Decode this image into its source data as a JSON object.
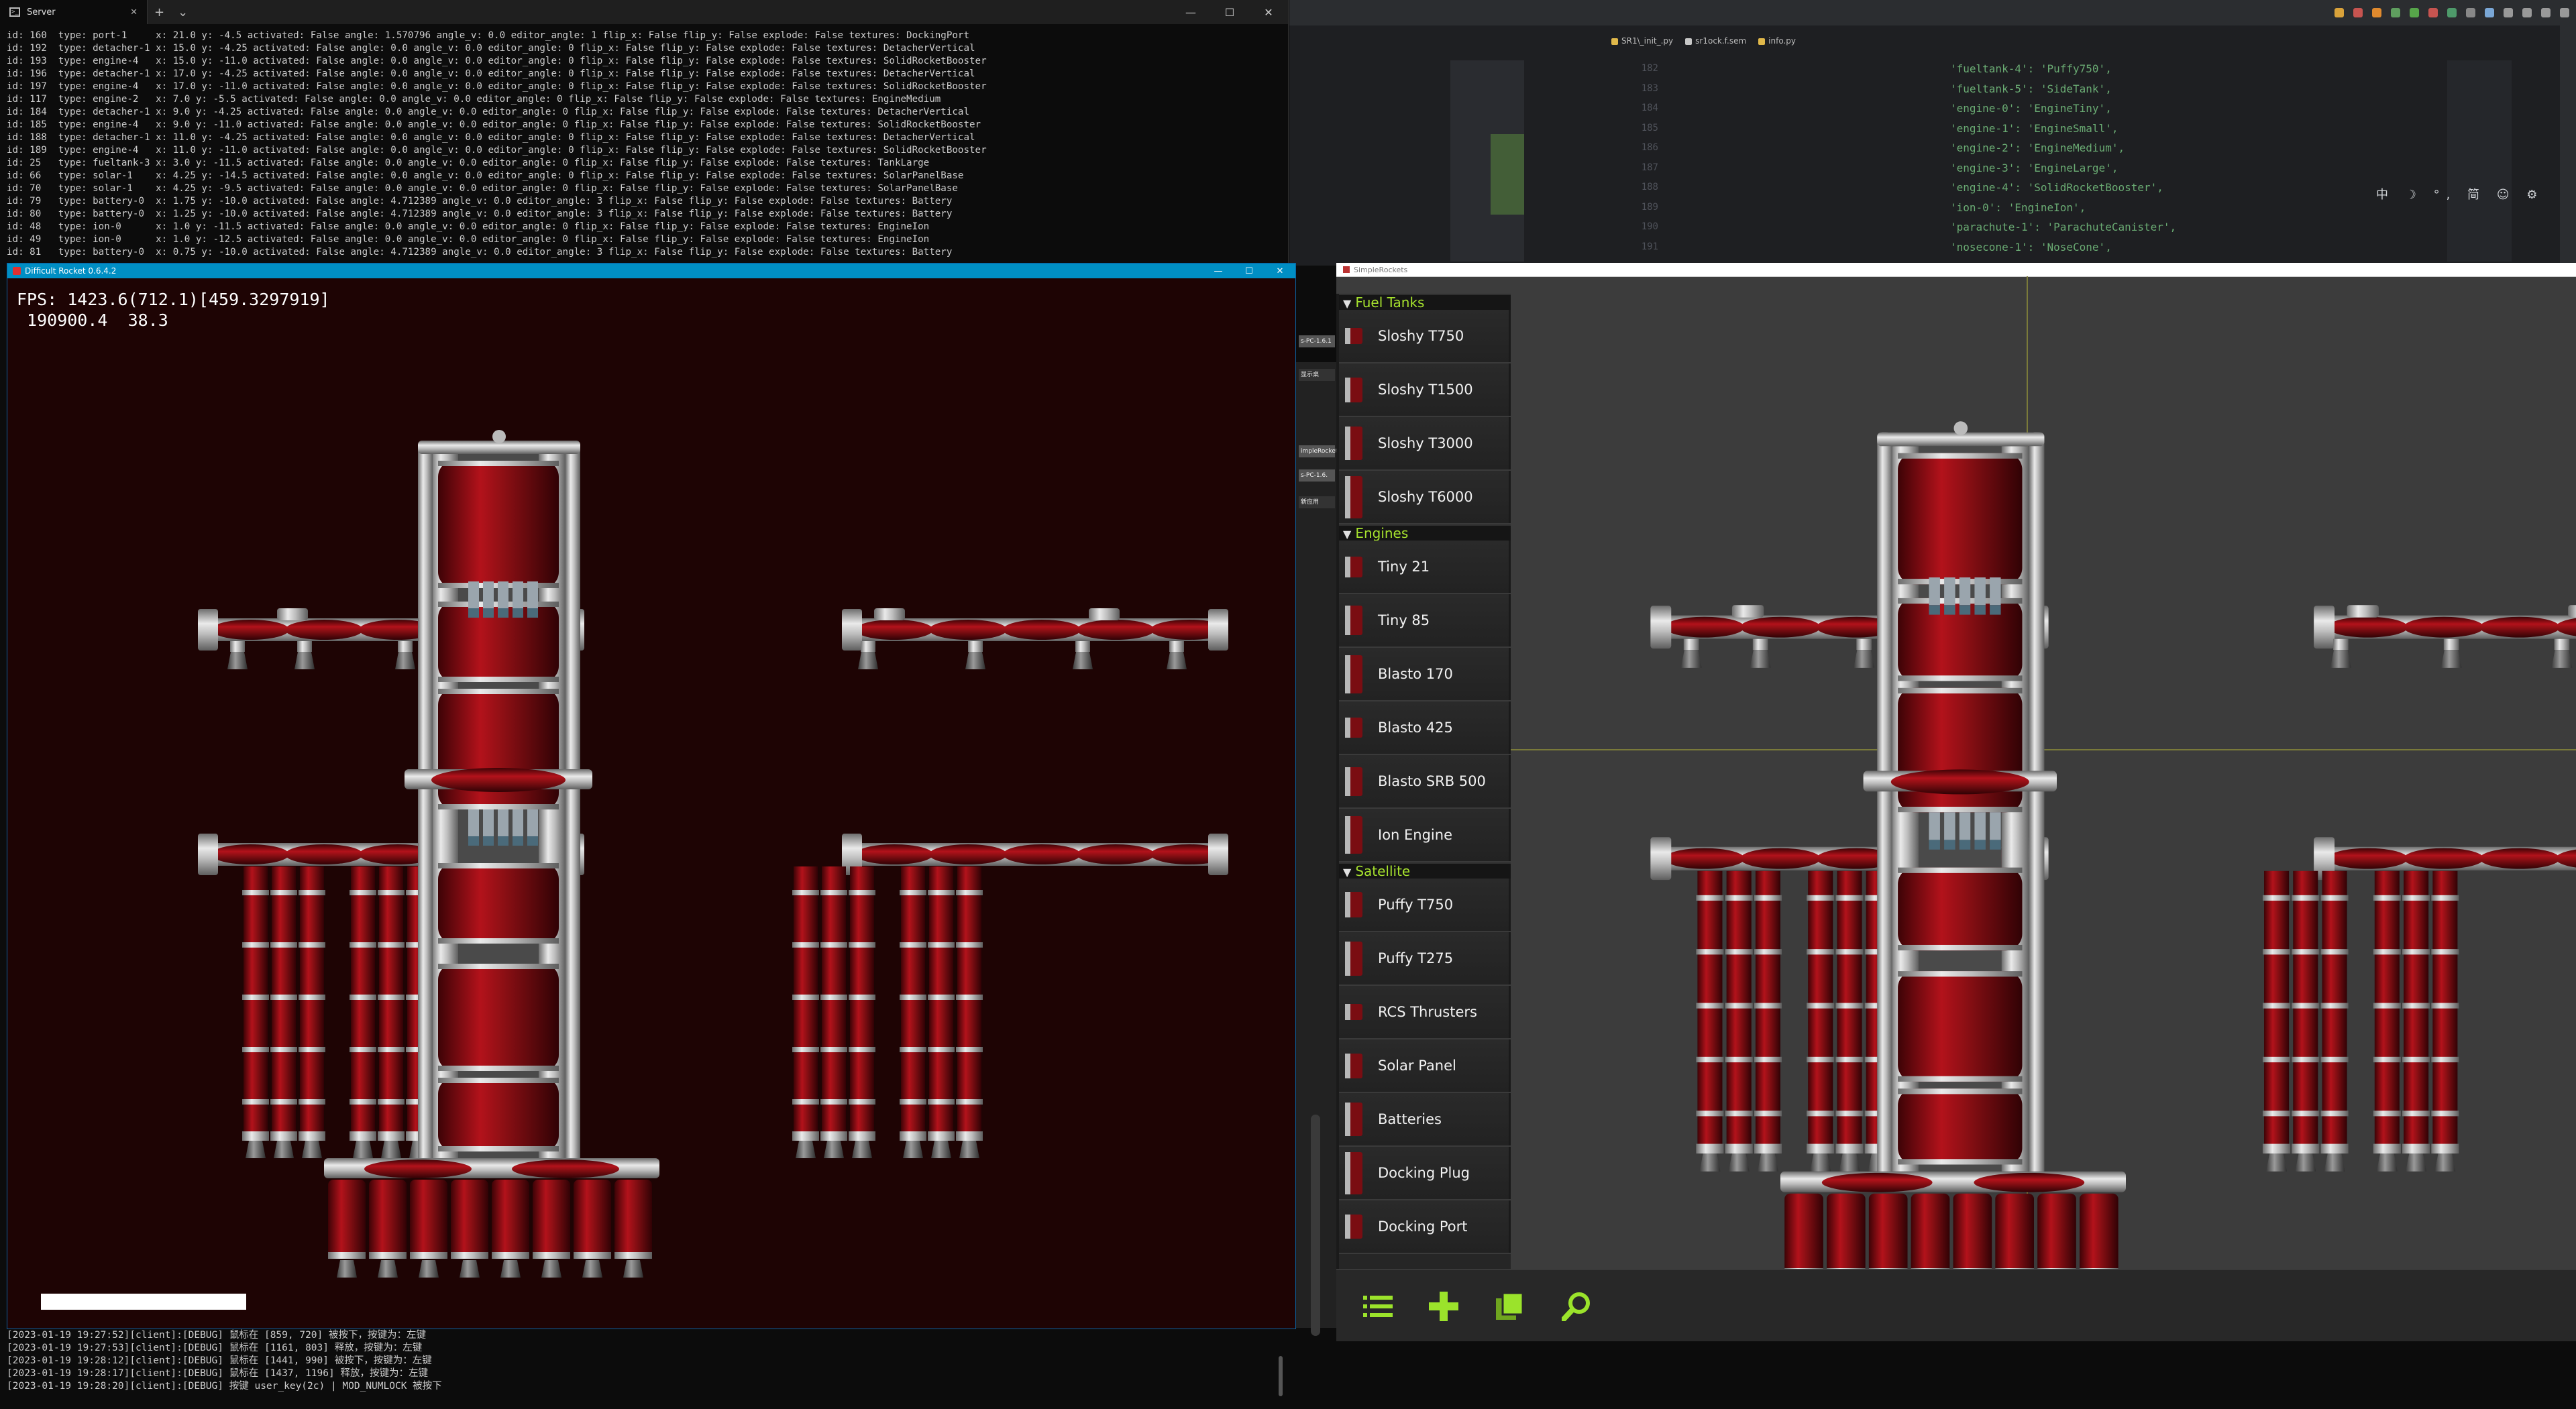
{
  "terminal": {
    "tab_title": "Server",
    "lines": [
      "id: 160  type: port-1     x: 21.0 y: -4.5 activated: False angle: 1.570796 angle_v: 0.0 editor_angle: 1 flip_x: False flip_y: False explode: False textures: DockingPort",
      "id: 192  type: detacher-1 x: 15.0 y: -4.25 activated: False angle: 0.0 angle_v: 0.0 editor_angle: 0 flip_x: False flip_y: False explode: False textures: DetacherVertical",
      "id: 193  type: engine-4   x: 15.0 y: -11.0 activated: False angle: 0.0 angle_v: 0.0 editor_angle: 0 flip_x: False flip_y: False explode: False textures: SolidRocketBooster",
      "id: 196  type: detacher-1 x: 17.0 y: -4.25 activated: False angle: 0.0 angle_v: 0.0 editor_angle: 0 flip_x: False flip_y: False explode: False textures: DetacherVertical",
      "id: 197  type: engine-4   x: 17.0 y: -11.0 activated: False angle: 0.0 angle_v: 0.0 editor_angle: 0 flip_x: False flip_y: False explode: False textures: SolidRocketBooster",
      "id: 117  type: engine-2   x: 7.0 y: -5.5 activated: False angle: 0.0 angle_v: 0.0 editor_angle: 0 flip_x: False flip_y: False explode: False textures: EngineMedium",
      "id: 184  type: detacher-1 x: 9.0 y: -4.25 activated: False angle: 0.0 angle_v: 0.0 editor_angle: 0 flip_x: False flip_y: False explode: False textures: DetacherVertical",
      "id: 185  type: engine-4   x: 9.0 y: -11.0 activated: False angle: 0.0 angle_v: 0.0 editor_angle: 0 flip_x: False flip_y: False explode: False textures: SolidRocketBooster",
      "id: 188  type: detacher-1 x: 11.0 y: -4.25 activated: False angle: 0.0 angle_v: 0.0 editor_angle: 0 flip_x: False flip_y: False explode: False textures: DetacherVertical",
      "id: 189  type: engine-4   x: 11.0 y: -11.0 activated: False angle: 0.0 angle_v: 0.0 editor_angle: 0 flip_x: False flip_y: False explode: False textures: SolidRocketBooster",
      "id: 25   type: fueltank-3 x: 3.0 y: -11.5 activated: False angle: 0.0 angle_v: 0.0 editor_angle: 0 flip_x: False flip_y: False explode: False textures: TankLarge",
      "id: 66   type: solar-1    x: 4.25 y: -14.5 activated: False angle: 0.0 angle_v: 0.0 editor_angle: 0 flip_x: False flip_y: False explode: False textures: SolarPanelBase",
      "id: 70   type: solar-1    x: 4.25 y: -9.5 activated: False angle: 0.0 angle_v: 0.0 editor_angle: 0 flip_x: False flip_y: False explode: False textures: SolarPanelBase",
      "id: 79   type: battery-0  x: 1.75 y: -10.0 activated: False angle: 4.712389 angle_v: 0.0 editor_angle: 3 flip_x: False flip_y: False explode: False textures: Battery",
      "id: 80   type: battery-0  x: 1.25 y: -10.0 activated: False angle: 4.712389 angle_v: 0.0 editor_angle: 3 flip_x: False flip_y: False explode: False textures: Battery",
      "id: 48   type: ion-0      x: 1.0 y: -11.5 activated: False angle: 0.0 angle_v: 0.0 editor_angle: 0 flip_x: False flip_y: False explode: False textures: EngineIon",
      "id: 49   type: ion-0      x: 1.0 y: -12.5 activated: False angle: 0.0 angle_v: 0.0 editor_angle: 0 flip_x: False flip_y: False explode: False textures: EngineIon",
      "id: 81   type: battery-0  x: 0.75 y: -10.0 activated: False angle: 4.712389 angle_v: 0.0 editor_angle: 3 flip_x: False flip_y: False explode: False textures: Battery"
    ]
  },
  "game": {
    "title": "Difficult Rocket 0.6.4.2",
    "fps_line": "FPS: 1423.6(712.1)[459.3297919]",
    "stats_line": " 190900.4  38.3"
  },
  "log": {
    "lines": [
      "[2023-01-19 19:27:52][client]:[DEBUG] 鼠标在 [859, 720] 被按下，按键为：左键",
      "[2023-01-19 19:27:53][client]:[DEBUG] 鼠标在 [1161, 803] 释放，按键为：左键",
      "[2023-01-19 19:28:12][client]:[DEBUG] 鼠标在 [1441, 990] 被按下，按键为：左键",
      "[2023-01-19 19:28:17][client]:[DEBUG] 鼠标在 [1437, 1196] 释放，按键为：左键",
      "[2023-01-19 19:28:20][client]:[DEBUG] 按键 user_key(2c) | MOD_NUMLOCK 被按下"
    ]
  },
  "ide": {
    "tabs": [
      "SR1\\_init_.py",
      "sr1ock.f.sem",
      "info.py"
    ],
    "line_numbers": [
      "182",
      "183",
      "184",
      "185",
      "186",
      "187",
      "188",
      "189",
      "190",
      "191"
    ],
    "code_lines": [
      "'fueltank-4': 'Puffy750',",
      "'fueltank-5': 'SideTank',",
      "'engine-0': 'EngineTiny',",
      "'engine-1': 'EngineSmall',",
      "'engine-2': 'EngineMedium',",
      "'engine-3': 'EngineLarge',",
      "'engine-4': 'SolidRocketBooster',",
      "'ion-0': 'EngineIon',",
      "'parachute-1': 'ParachuteCanister',",
      "'nosecone-1': 'NoseCone',"
    ],
    "ime": "中 ☽ °, 简 ☺ ⚙"
  },
  "sliver": {
    "chip1": "s-PC-1.6.1",
    "chip2": "显示桌",
    "chip3": "impleRocket",
    "chip4": "s-PC-1.6.",
    "chip5": "新应用"
  },
  "sr": {
    "title": "SimpleRockets",
    "categories": [
      {
        "name": "Fuel Tanks",
        "parts": [
          "Sloshy T750",
          "Sloshy T1500",
          "Sloshy T3000",
          "Sloshy T6000"
        ]
      },
      {
        "name": "Engines",
        "parts": [
          "Tiny 21",
          "Tiny 85",
          "Blasto 170",
          "Blasto 425",
          "Blasto SRB 500",
          "Ion Engine"
        ]
      },
      {
        "name": "Satellite",
        "parts": [
          "Puffy T750",
          "Puffy T275",
          "RCS Thrusters",
          "Solar Panel",
          "Batteries",
          "Docking Plug",
          "Docking Port"
        ]
      }
    ],
    "toolbar": [
      "list-icon",
      "plus-icon",
      "copy-icon",
      "search-icon"
    ]
  },
  "colors": {
    "accent_green": "#a6e22e",
    "title_blue": "#008fc4",
    "tank_red": "#8b0f14"
  }
}
